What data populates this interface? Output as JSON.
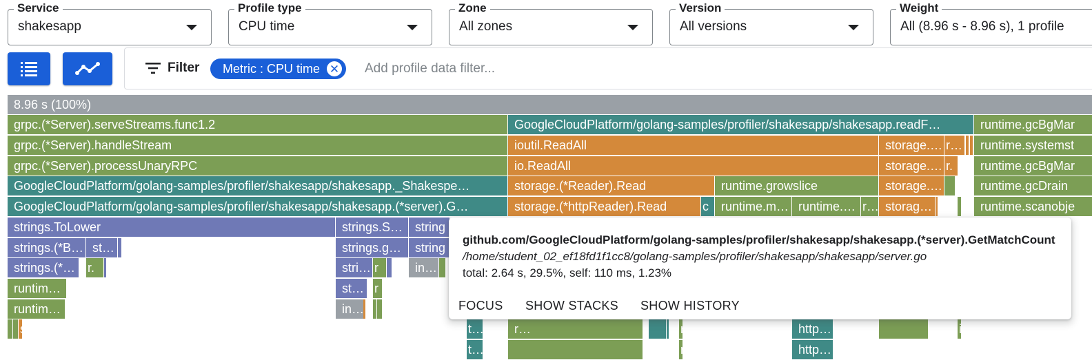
{
  "fields": {
    "service": {
      "label": "Service",
      "value": "shakesapp"
    },
    "profile_type": {
      "label": "Profile type",
      "value": "CPU time"
    },
    "zone": {
      "label": "Zone",
      "value": "All zones"
    },
    "version": {
      "label": "Version",
      "value": "All versions"
    },
    "weight": {
      "label": "Weight",
      "value": "All (8.96 s - 8.96 s), 1 profile"
    }
  },
  "view_buttons": [
    {
      "icon": "list-icon"
    },
    {
      "icon": "line-chart-icon"
    }
  ],
  "filter": {
    "label": "Filter",
    "chip": {
      "key": "Metric",
      "sep": " : ",
      "value": "CPU time"
    },
    "placeholder": "Add profile data filter..."
  },
  "colors": {
    "root": "#9aa0a6",
    "green": "#7c9e55",
    "orange": "#d4893a",
    "teal": "#3f8a86",
    "purple": "#6f79b6",
    "gray": "#9aa0a6",
    "accent": "#1a5fd8"
  },
  "flame": {
    "root": "8.96 s (100%)",
    "frames": [
      {
        "text": "grpc.(*Server).serveStreams.func1.2",
        "color": "green"
      },
      {
        "text": "GoogleCloudPlatform/golang-samples/profiler/shakesapp/shakesapp.readF…",
        "color": "teal"
      },
      {
        "text": "runtime.gcBgMar",
        "color": "green"
      },
      {
        "text": "grpc.(*Server).handleStream",
        "color": "green"
      },
      {
        "text": "ioutil.ReadAll",
        "color": "orange"
      },
      {
        "text": "storage.…",
        "color": "orange"
      },
      {
        "text": "r…",
        "color": "orange"
      },
      {
        "text": "",
        "color": "orange"
      },
      {
        "text": "",
        "color": "orange"
      },
      {
        "text": "runtime.systemst",
        "color": "green"
      },
      {
        "text": "grpc.(*Server).processUnaryRPC",
        "color": "green"
      },
      {
        "text": "io.ReadAll",
        "color": "orange"
      },
      {
        "text": "storage.…",
        "color": "orange"
      },
      {
        "text": "r.",
        "color": "orange"
      },
      {
        "text": "runtime.gcBgMar",
        "color": "green"
      },
      {
        "text": "GoogleCloudPlatform/golang-samples/profiler/shakesapp/shakesapp._Shakespe…",
        "color": "teal"
      },
      {
        "text": "storage.(*Reader).Read",
        "color": "orange"
      },
      {
        "text": "runtime.growslice",
        "color": "green"
      },
      {
        "text": "storage.…",
        "color": "orange"
      },
      {
        "text": "",
        "color": "green"
      },
      {
        "text": "runtime.gcDrain",
        "color": "green"
      },
      {
        "text": "GoogleCloudPlatform/golang-samples/profiler/shakesapp/shakesapp.(*server).G…",
        "color": "teal"
      },
      {
        "text": "storage.(*httpReader).Read",
        "color": "orange"
      },
      {
        "text": "c",
        "color": "teal"
      },
      {
        "text": "runtime.m…",
        "color": "green"
      },
      {
        "text": "runtime.…",
        "color": "green"
      },
      {
        "text": "r…",
        "color": "green"
      },
      {
        "text": "storag…",
        "color": "orange"
      },
      {
        "text": "",
        "color": "orange"
      },
      {
        "text": "",
        "color": "green"
      },
      {
        "text": "runtime.scanobje",
        "color": "green"
      },
      {
        "text": "strings.ToLower",
        "color": "purple"
      },
      {
        "text": "strings.S…",
        "color": "purple"
      },
      {
        "text": "string",
        "color": "purple"
      },
      {
        "text": "strings.(*B…",
        "color": "purple"
      },
      {
        "text": "st…",
        "color": "purple"
      },
      {
        "text": "",
        "color": "purple"
      },
      {
        "text": "strings.ge…",
        "color": "purple"
      },
      {
        "text": "string",
        "color": "purple"
      },
      {
        "text": "strings.(*…",
        "color": "purple"
      },
      {
        "text": "r.",
        "color": "green"
      },
      {
        "text": "",
        "color": "purple"
      },
      {
        "text": "stri…",
        "color": "purple"
      },
      {
        "text": "r",
        "color": "green"
      },
      {
        "text": "",
        "color": "purple"
      },
      {
        "text": "in…",
        "color": "gray"
      },
      {
        "text": "",
        "color": "green"
      },
      {
        "text": "runtim…",
        "color": "green"
      },
      {
        "text": "str…",
        "color": "purple"
      },
      {
        "text": "r",
        "color": "green"
      },
      {
        "text": "runtim…",
        "color": "green"
      },
      {
        "text": "in…",
        "color": "gray"
      },
      {
        "text": "",
        "color": "orange"
      },
      {
        "text": "",
        "color": "green"
      },
      {
        "text": "",
        "color": "green"
      },
      {
        "text": "",
        "color": "green"
      },
      {
        "text": "",
        "color": "green"
      },
      {
        "text": "s.",
        "color": "orange"
      },
      {
        "text": "tls.(*Conn).Write",
        "color": "teal"
      },
      {
        "text": "r…",
        "color": "green"
      },
      {
        "text": "",
        "color": "teal"
      },
      {
        "text": "",
        "color": "teal"
      },
      {
        "text": "runt…",
        "color": "green"
      },
      {
        "text": "http.(…",
        "color": "teal"
      },
      {
        "text": "",
        "color": "green"
      },
      {
        "text": "i…",
        "color": "green"
      },
      {
        "text": "tls.(*Conn).writeRec…",
        "color": "teal"
      },
      {
        "text": "",
        "color": "green"
      },
      {
        "text": "runt…",
        "color": "green"
      },
      {
        "text": "http.(…",
        "color": "teal"
      }
    ]
  },
  "tooltip": {
    "name": "github.com/GoogleCloudPlatform/golang-samples/profiler/shakesapp/shakesapp.(*server).GetMatchCount",
    "path": "/home/student_02_ef18fd1f1cc8/golang-samples/profiler/shakesapp/shakesapp/server.go",
    "stats": "total: 2.64 s, 29.5%, self: 110 ms, 1.23%",
    "actions": [
      "FOCUS",
      "SHOW STACKS",
      "SHOW HISTORY"
    ]
  }
}
